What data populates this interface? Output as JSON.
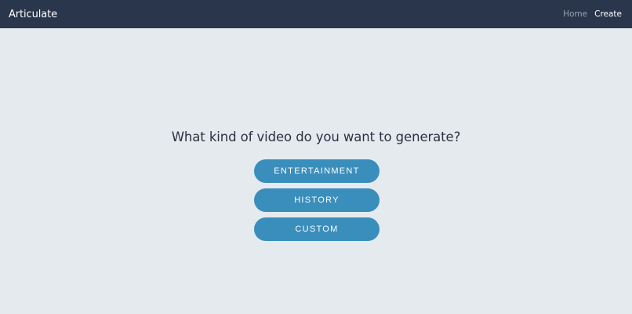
{
  "navbar": {
    "brand": "Articulate",
    "links": [
      {
        "label": "Home",
        "active": false
      },
      {
        "label": "Create",
        "active": true
      }
    ]
  },
  "main": {
    "question": "What kind of video do you want to generate?",
    "options": [
      {
        "label": "ENTERTAINMENT"
      },
      {
        "label": "HISTORY"
      },
      {
        "label": "CUSTOM"
      }
    ]
  },
  "colors": {
    "navbar_bg": "#29364c",
    "page_bg": "#e5eaef",
    "button_bg": "#3a8ebc",
    "text_dark": "#2b3240",
    "nav_inactive": "#9aa4b2"
  }
}
